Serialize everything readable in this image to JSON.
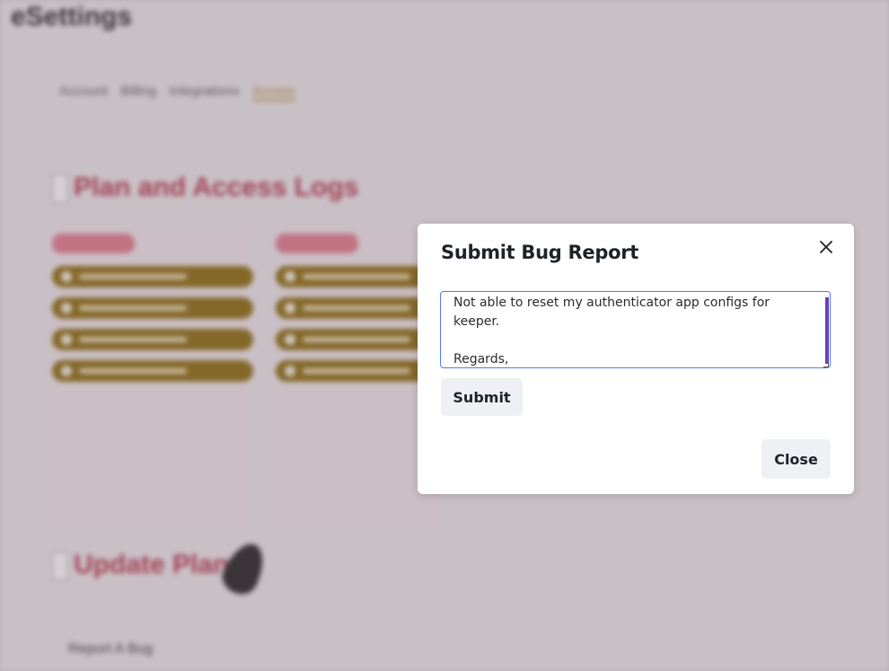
{
  "background": {
    "app_title": "eSettings",
    "nav_tabs": [
      "Account",
      "Billing",
      "Integrations",
      "Access"
    ],
    "section_plan_title": "Plan and Access Logs",
    "section_update_title": "Update Plan",
    "report_link": "Report A Bug"
  },
  "modal": {
    "title": "Submit Bug Report",
    "close_icon": "close-icon",
    "report_text": "Not able to reset my authenticator app configs for keeper.\n\nRegards,\nJohn Wick",
    "submit_label": "Submit",
    "close_label": "Close"
  },
  "colors": {
    "focus_border": "#4d79ff",
    "scrollbar": "#6a3fb8",
    "button_bg": "#eef0f3"
  }
}
